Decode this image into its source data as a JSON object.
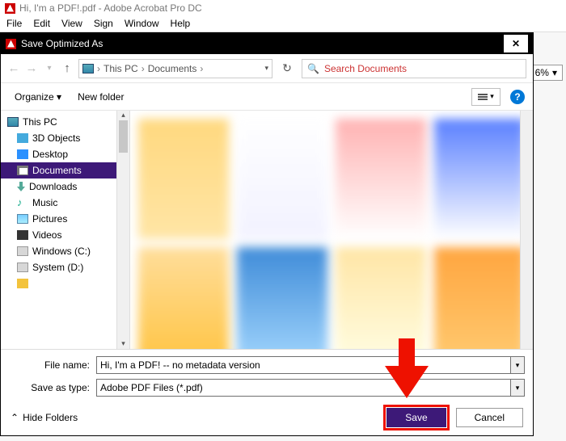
{
  "app": {
    "title": "Hi, I'm a PDF!.pdf - Adobe Acrobat Pro DC"
  },
  "menu": {
    "file": "File",
    "edit": "Edit",
    "view": "View",
    "sign": "Sign",
    "window": "Window",
    "help": "Help"
  },
  "zoom": {
    "value": "6%"
  },
  "dialog": {
    "title": "Save Optimized As",
    "breadcrumb": {
      "root": "This PC",
      "folder": "Documents"
    },
    "search_placeholder": "Search Documents",
    "organize": "Organize",
    "new_folder": "New folder",
    "tree": {
      "this_pc": "This PC",
      "objects_3d": "3D Objects",
      "desktop": "Desktop",
      "documents": "Documents",
      "downloads": "Downloads",
      "music": "Music",
      "pictures": "Pictures",
      "videos": "Videos",
      "win_c": "Windows (C:)",
      "sys_d": "System (D:)",
      "libraries_stub": ""
    },
    "file_name_label": "File name:",
    "file_name_value": "Hi, I'm a PDF! -- no metadata version",
    "save_type_label": "Save as type:",
    "save_type_value": "Adobe PDF Files (*.pdf)",
    "hide_folders": "Hide Folders",
    "save": "Save",
    "cancel": "Cancel"
  }
}
